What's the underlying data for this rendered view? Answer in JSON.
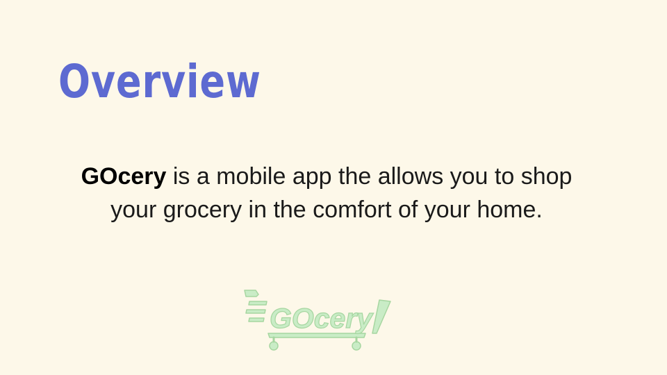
{
  "slide": {
    "title": "Overview",
    "body": {
      "brand": "GOcery",
      "text": " is a mobile app the allows you to shop your grocery in the comfort of your home."
    },
    "logo": {
      "wordmark": "GOcery",
      "icon": "shopping-cart-icon"
    }
  },
  "colors": {
    "background": "#fdf8e9",
    "title": "#5d6ad1",
    "body_text": "#1a1a1a",
    "logo_fill": "#c9ecc6",
    "logo_stroke": "#a6d6a0"
  }
}
